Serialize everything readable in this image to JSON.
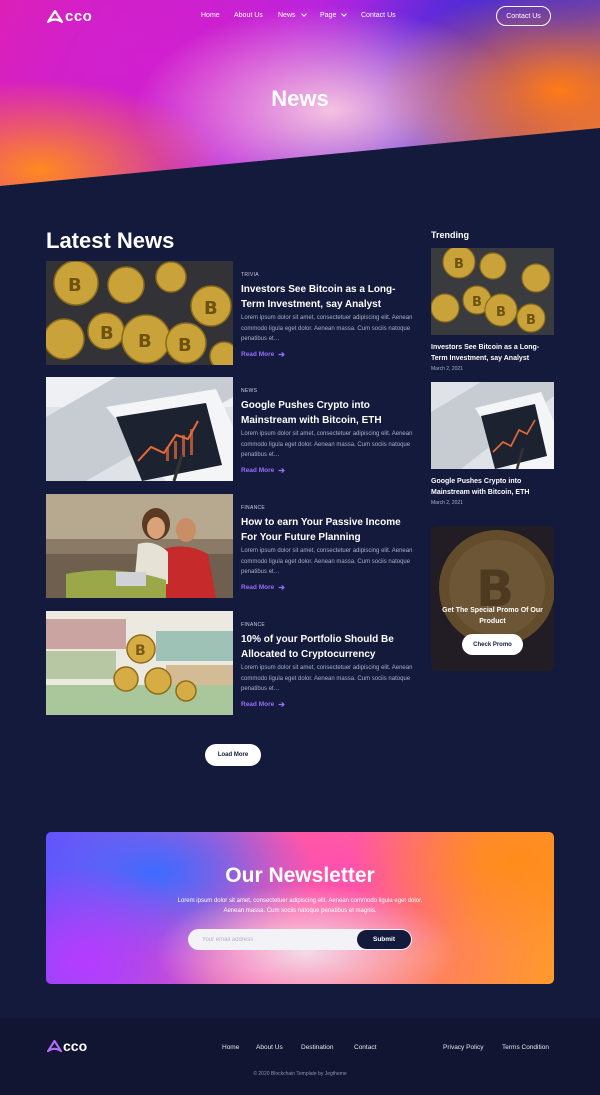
{
  "brand": {
    "name": "cco"
  },
  "nav": {
    "items": [
      {
        "label": "Home"
      },
      {
        "label": "About Us"
      },
      {
        "label": "News"
      },
      {
        "label": "Page"
      },
      {
        "label": "Contact Us"
      }
    ],
    "cta": "Contact Us"
  },
  "hero": {
    "title": "News"
  },
  "latest": {
    "title": "Latest News",
    "read_more": "Read More",
    "posts": [
      {
        "category": "TRIVIA",
        "title": "Investors See Bitcoin as a Long-Term Investment, say Analyst",
        "excerpt": "Lorem ipsum dolor sit amet, consectetuer adipiscing elit. Aenean commodo ligula eget dolor. Aenean massa. Cum sociis natoque penatibus et…"
      },
      {
        "category": "NEWS",
        "title": "Google Pushes Crypto into Mainstream with Bitcoin, ETH",
        "excerpt": "Lorem ipsum dolor sit amet, consectetuer adipiscing elit. Aenean commodo ligula eget dolor. Aenean massa. Cum sociis natoque penatibus et…"
      },
      {
        "category": "FINANCE",
        "title": "How to earn Your Passive Income For Your Future Planning",
        "excerpt": "Lorem ipsum dolor sit amet, consectetuer adipiscing elit. Aenean commodo ligula eget dolor. Aenean massa. Cum sociis natoque penatibus et…"
      },
      {
        "category": "FINANCE",
        "title": "10% of your Portfolio Should Be Allocated to Cryptocurrency",
        "excerpt": "Lorem ipsum dolor sit amet, consectetuer adipiscing elit. Aenean commodo ligula eget dolor. Aenean massa. Cum sociis natoque penatibus et…"
      }
    ],
    "load_more": "Load More"
  },
  "trending": {
    "title": "Trending",
    "items": [
      {
        "title": "Investors See Bitcoin as a Long-Term Investment, say Analyst",
        "date": "March 2, 2021"
      },
      {
        "title": "Google Pushes Crypto into Mainstream with Bitcoin, ETH",
        "date": "March 2, 2021"
      }
    ]
  },
  "promo": {
    "text": "Get The Special Promo Of Our Product",
    "button": "Check Promo"
  },
  "newsletter": {
    "title": "Our Newsletter",
    "text": "Lorem ipsum dolor sit amet, consectetuer adipiscing elit. Aenean commodo ligula eget dolor. Aenean massa. Cum sociis natoque penatibus et magnis.",
    "placeholder": "Your email address",
    "button": "Submit"
  },
  "footer": {
    "links": [
      {
        "label": "Home"
      },
      {
        "label": "About Us"
      },
      {
        "label": "Destination"
      },
      {
        "label": "Contact"
      },
      {
        "label": "Privacy Policy"
      },
      {
        "label": "Terms Condition"
      }
    ],
    "copyright": "© 2020 Blockchain Template by Jegtheme"
  },
  "colors": {
    "background": "#141a3b",
    "accent": "#9a6cff",
    "footer": "#111531"
  }
}
